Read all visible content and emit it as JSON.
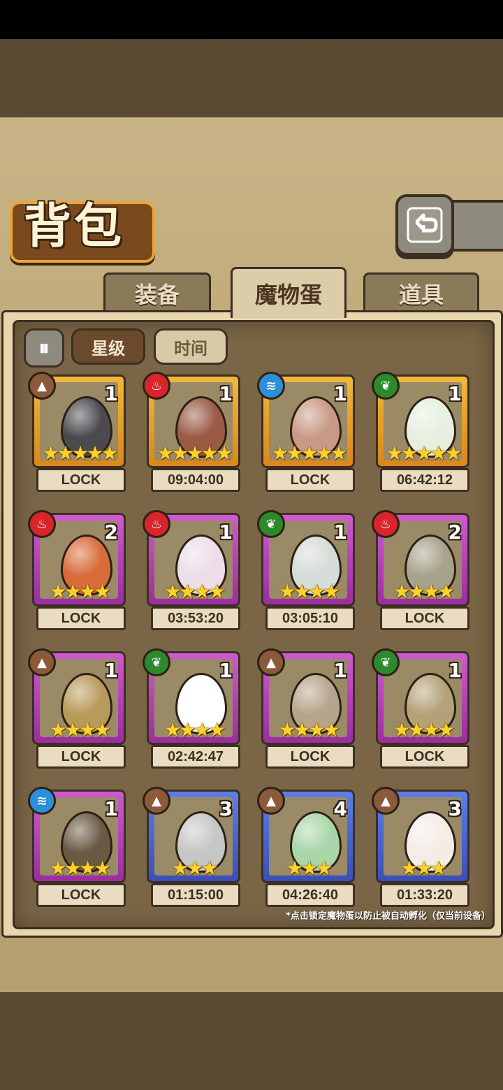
{
  "header": {
    "title": "背包"
  },
  "tabs": [
    {
      "label": "装备",
      "active": false
    },
    {
      "label": "魔物蛋",
      "active": true
    },
    {
      "label": "道具",
      "active": false
    }
  ],
  "sort": {
    "toggle_icon": "sort-toggle-icon",
    "chips": [
      {
        "label": "星级",
        "selected": true
      },
      {
        "label": "时间",
        "selected": false
      }
    ]
  },
  "eggs": [
    {
      "element": "earth",
      "rarity": "gold",
      "count": "1",
      "stars": "★★★★★",
      "label": "LOCK",
      "egg_color": "#4b4a4e"
    },
    {
      "element": "fire",
      "rarity": "gold",
      "count": "1",
      "stars": "★★★★★",
      "label": "09:04:00",
      "egg_color": "#9a5a44"
    },
    {
      "element": "water",
      "rarity": "gold",
      "count": "1",
      "stars": "★★★★★",
      "label": "LOCK",
      "egg_color": "#c89a86"
    },
    {
      "element": "grass",
      "rarity": "gold",
      "count": "1",
      "stars": "★★★★★",
      "label": "06:42:12",
      "egg_color": "#e6efe0"
    },
    {
      "element": "fire",
      "rarity": "purple",
      "count": "2",
      "stars": "★★★★",
      "label": "LOCK",
      "egg_color": "#d96a3a"
    },
    {
      "element": "fire",
      "rarity": "purple",
      "count": "1",
      "stars": "★★★★",
      "label": "03:53:20",
      "egg_color": "#ecdde8"
    },
    {
      "element": "grass",
      "rarity": "purple",
      "count": "1",
      "stars": "★★★★",
      "label": "03:05:10",
      "egg_color": "#d6dcd8"
    },
    {
      "element": "fire",
      "rarity": "purple",
      "count": "2",
      "stars": "★★★★",
      "label": "LOCK",
      "egg_color": "#a7a28c"
    },
    {
      "element": "earth",
      "rarity": "purple",
      "count": "1",
      "stars": "★★★★",
      "label": "LOCK",
      "egg_color": "#b89a5a"
    },
    {
      "element": "grass",
      "rarity": "purple",
      "count": "1",
      "stars": "★★★★",
      "label": "02:42:47",
      "egg_color": "#ffffff"
    },
    {
      "element": "earth",
      "rarity": "purple",
      "count": "1",
      "stars": "★★★★",
      "label": "LOCK",
      "egg_color": "#b6a58c"
    },
    {
      "element": "grass",
      "rarity": "purple",
      "count": "1",
      "stars": "★★★★",
      "label": "LOCK",
      "egg_color": "#b3a278"
    },
    {
      "element": "water",
      "rarity": "purple",
      "count": "1",
      "stars": "★★★★",
      "label": "LOCK",
      "egg_color": "#6a5a44"
    },
    {
      "element": "earth",
      "rarity": "blue",
      "count": "3",
      "stars": "★★★",
      "label": "01:15:00",
      "egg_color": "#c6c6c6"
    },
    {
      "element": "earth",
      "rarity": "blue",
      "count": "4",
      "stars": "★★★",
      "label": "04:26:40",
      "egg_color": "#a9d6a8"
    },
    {
      "element": "earth",
      "rarity": "blue",
      "count": "3",
      "stars": "★★★",
      "label": "01:33:20",
      "egg_color": "#f4ede6"
    }
  ],
  "element_icons": {
    "earth": "mountain-icon",
    "fire": "flame-icon",
    "water": "wave-icon",
    "grass": "leaf-icon"
  },
  "footnote": "*点击锁定魔物蛋以防止被自动孵化（仅当前设备）"
}
